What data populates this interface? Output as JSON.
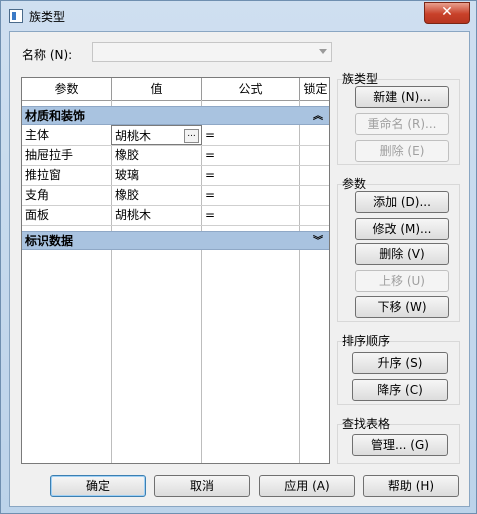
{
  "window": {
    "title": "族类型",
    "close_glyph": "✕"
  },
  "name_field": {
    "label": "名称 (N):",
    "value": ""
  },
  "table": {
    "headers": [
      "参数",
      "值",
      "公式",
      "锁定"
    ],
    "groups": [
      {
        "title": "材质和装饰",
        "chevron": "︽",
        "rows": [
          {
            "param": "主体",
            "value": "胡桃木",
            "formula": "="
          },
          {
            "param": "抽屉拉手",
            "value": "橡胶",
            "formula": "="
          },
          {
            "param": "推拉窗",
            "value": "玻璃",
            "formula": "="
          },
          {
            "param": "支角",
            "value": "橡胶",
            "formula": "="
          },
          {
            "param": "面板",
            "value": "胡桃木",
            "formula": "="
          }
        ]
      },
      {
        "title": "标识数据",
        "chevron": "︾",
        "rows": []
      }
    ],
    "ellipsis": "..."
  },
  "family_types": {
    "title": "族类型",
    "new": "新建 (N)...",
    "rename": "重命名 (R)...",
    "delete": "删除 (E)"
  },
  "parameters": {
    "title": "参数",
    "add": "添加 (D)...",
    "modify": "修改 (M)...",
    "delete": "删除 (V)",
    "move_up": "上移 (U)",
    "move_down": "下移 (W)"
  },
  "sort": {
    "title": "排序顺序",
    "ascending": "升序 (S)",
    "descending": "降序 (C)"
  },
  "lookup": {
    "title": "查找表格",
    "manage": "管理... (G)"
  },
  "footer": {
    "ok": "确定",
    "cancel": "取消",
    "apply": "应用 (A)",
    "help": "帮助 (H)"
  }
}
